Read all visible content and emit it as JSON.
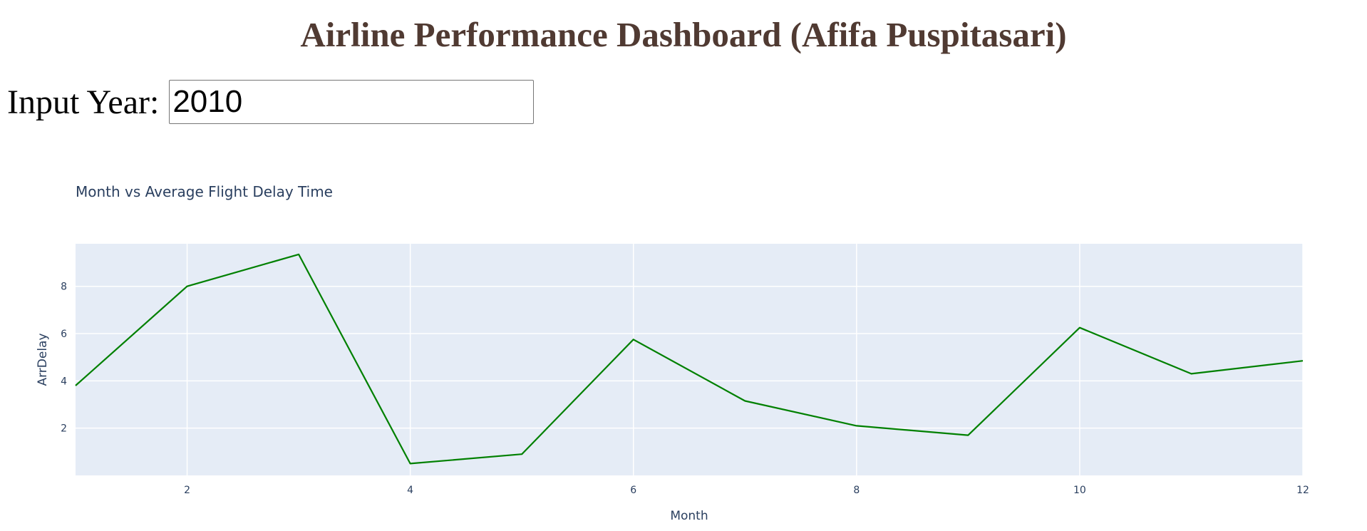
{
  "header": {
    "title": "Airline Performance Dashboard (Afifa Puspitasari)"
  },
  "year_input": {
    "label": "Input Year:",
    "value": "2010"
  },
  "colors": {
    "title": "#503A32",
    "line": "#008000",
    "plot_bg": "#E5ECF6",
    "grid": "#FFFFFF",
    "axis_text": "#2A3F5F"
  },
  "chart_data": {
    "type": "line",
    "title": "Month vs Average Flight Delay Time",
    "xlabel": "Month",
    "ylabel": "ArrDelay",
    "xlim": [
      1,
      12
    ],
    "ylim": [
      0,
      9.8
    ],
    "x_ticks": [
      2,
      4,
      6,
      8,
      10,
      12
    ],
    "y_ticks": [
      2,
      4,
      6,
      8
    ],
    "grid": true,
    "legend": "none",
    "series": [
      {
        "x": [
          1,
          2,
          3,
          4,
          5,
          6,
          7,
          8,
          9,
          10,
          11,
          12
        ],
        "y": [
          3.8,
          8.0,
          9.35,
          0.5,
          0.9,
          5.75,
          3.15,
          2.1,
          1.7,
          6.25,
          4.3,
          4.85
        ],
        "color": "#008000"
      }
    ]
  }
}
